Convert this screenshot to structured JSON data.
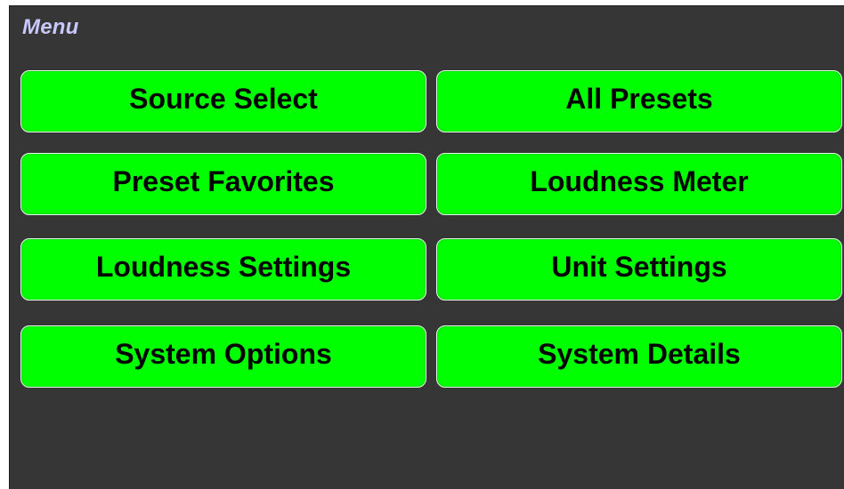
{
  "header": {
    "title": "Menu"
  },
  "menu": {
    "buttons": [
      {
        "label": "Source Select"
      },
      {
        "label": "All Presets"
      },
      {
        "label": "Preset Favorites"
      },
      {
        "label": "Loudness Meter"
      },
      {
        "label": "Loudness Settings"
      },
      {
        "label": "Unit Settings"
      },
      {
        "label": "System Options"
      },
      {
        "label": "System Details"
      }
    ]
  },
  "colors": {
    "background": "#363636",
    "button": "#00ff00",
    "title": "#c8c8ff",
    "button_text": "#000000"
  }
}
